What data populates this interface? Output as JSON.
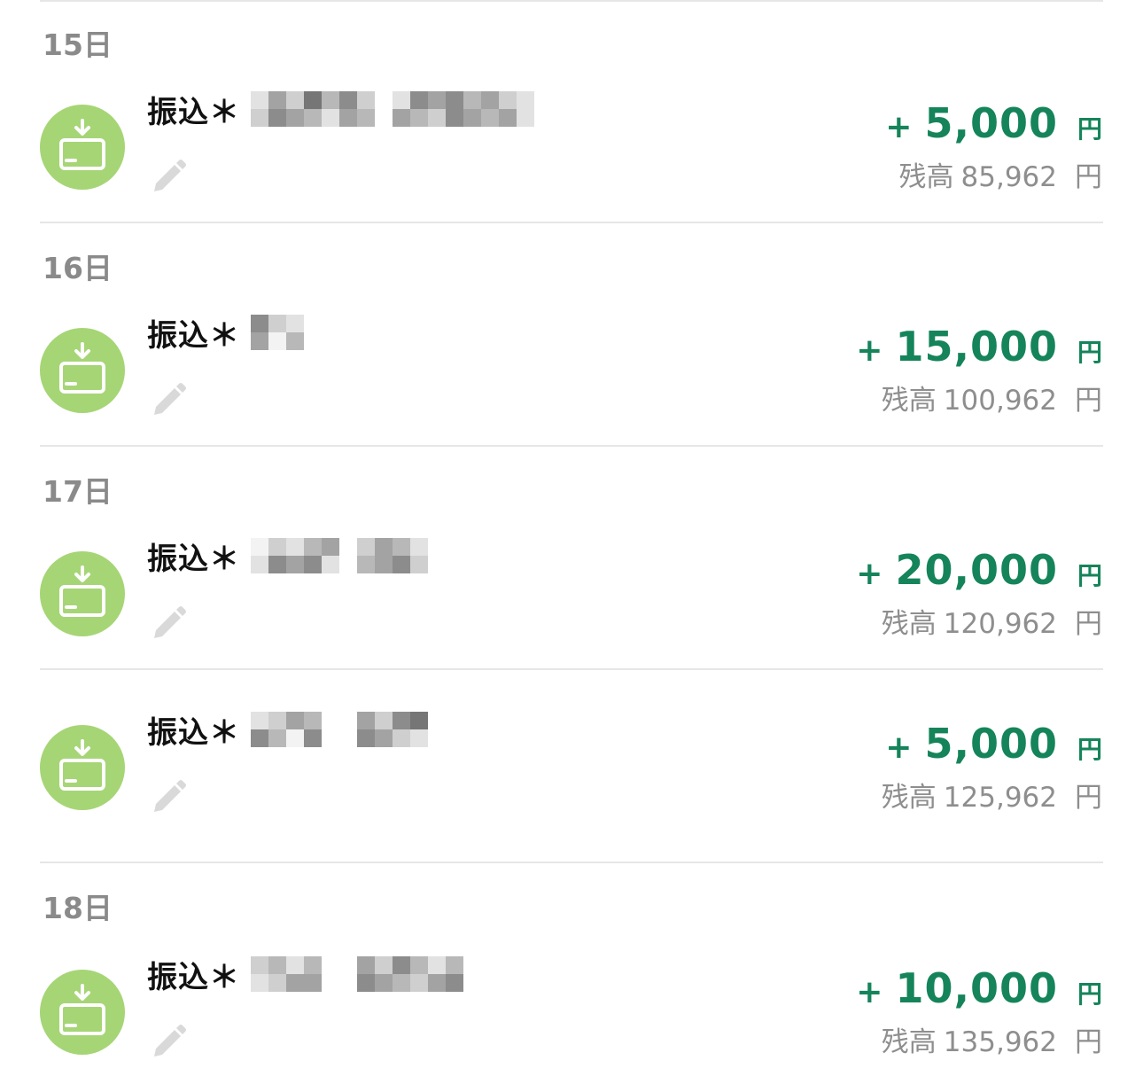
{
  "groups": [
    {
      "day": "15日",
      "entries": [
        {
          "title": "振込＊",
          "amount_sign": "+",
          "amount": "5,000",
          "amount_unit": "円",
          "balance_label": "残高",
          "balance": "85,962",
          "balance_unit": "円"
        }
      ]
    },
    {
      "day": "16日",
      "entries": [
        {
          "title": "振込＊",
          "amount_sign": "+",
          "amount": "15,000",
          "amount_unit": "円",
          "balance_label": "残高",
          "balance": "100,962",
          "balance_unit": "円"
        }
      ]
    },
    {
      "day": "17日",
      "entries": [
        {
          "title": "振込＊",
          "amount_sign": "+",
          "amount": "20,000",
          "amount_unit": "円",
          "balance_label": "残高",
          "balance": "120,962",
          "balance_unit": "円"
        },
        {
          "title": "振込＊",
          "amount_sign": "+",
          "amount": "5,000",
          "amount_unit": "円",
          "balance_label": "残高",
          "balance": "125,962",
          "balance_unit": "円"
        }
      ]
    },
    {
      "day": "18日",
      "entries": [
        {
          "title": "振込＊",
          "amount_sign": "+",
          "amount": "10,000",
          "amount_unit": "円",
          "balance_label": "残高",
          "balance": "135,962",
          "balance_unit": "円"
        }
      ]
    }
  ],
  "icons": {
    "transaction": "deposit-card-icon",
    "edit": "pencil-icon"
  },
  "colors": {
    "amount": "#15845a",
    "icon_circle": "#a6d576",
    "day_header": "#8a8a8a",
    "balance": "#8e8e8e",
    "redaction_mosaic": "#9a9a9a"
  }
}
